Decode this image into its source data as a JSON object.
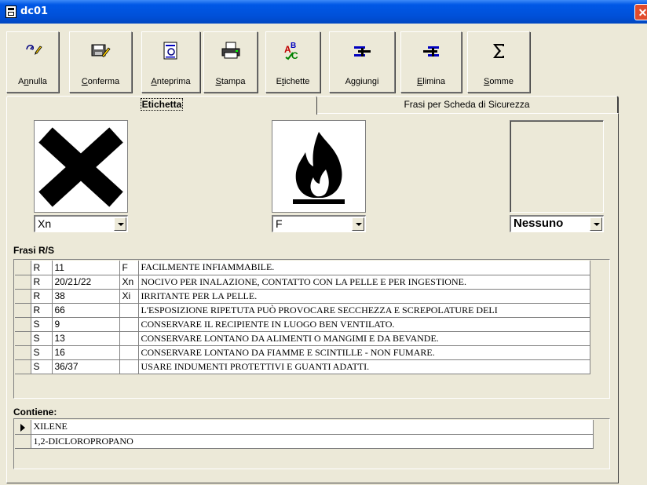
{
  "window": {
    "title": "dc01",
    "close_label": "✕"
  },
  "toolbar": [
    {
      "id": "annulla",
      "pre": "A",
      "u": "n",
      "post": "nulla",
      "icon": "undo-icon"
    },
    {
      "id": "conferma",
      "pre": "",
      "u": "C",
      "post": "onferma",
      "icon": "confirm-icon"
    },
    {
      "id": "anteprima",
      "pre": "",
      "u": "A",
      "post": "nteprima",
      "icon": "preview-icon"
    },
    {
      "id": "stampa",
      "pre": "",
      "u": "S",
      "post": "tampa",
      "icon": "printer-icon"
    },
    {
      "id": "etichette",
      "pre": "E",
      "u": "t",
      "post": "ichette",
      "icon": "labels-icon"
    },
    {
      "id": "aggiungi",
      "pre": "A",
      "u": "g",
      "post": "giungi",
      "icon": "add-icon"
    },
    {
      "id": "elimina",
      "pre": "",
      "u": "E",
      "post": "limina",
      "icon": "remove-icon"
    },
    {
      "id": "somme",
      "pre": "",
      "u": "S",
      "post": "omme",
      "icon": "sum-icon"
    }
  ],
  "tabs": [
    {
      "label": "Etichetta",
      "active": true
    },
    {
      "label": "Frasi per Scheda di Sicurezza",
      "active": false
    }
  ],
  "symbols": [
    {
      "value": "Xn",
      "icon": "harmful-x-icon"
    },
    {
      "value": "F",
      "icon": "flame-icon"
    },
    {
      "value": "Nessuno",
      "icon": ""
    }
  ],
  "phrases": {
    "label": "Frasi R/S",
    "rows": [
      {
        "type": "R",
        "number": "11",
        "symbol": "F",
        "text": "FACILMENTE INFIAMMABILE."
      },
      {
        "type": "R",
        "number": "20/21/22",
        "symbol": "Xn",
        "text": "NOCIVO PER INALAZIONE, CONTATTO CON LA PELLE E PER INGESTIONE."
      },
      {
        "type": "R",
        "number": "38",
        "symbol": "Xi",
        "text": "IRRITANTE PER LA PELLE."
      },
      {
        "type": "R",
        "number": "66",
        "symbol": "",
        "text": "L'ESPOSIZIONE RIPETUTA PUÒ PROVOCARE SECCHEZZA E SCREPOLATURE DELI"
      },
      {
        "type": "S",
        "number": "9",
        "symbol": "",
        "text": "CONSERVARE IL RECIPIENTE IN LUOGO BEN VENTILATO."
      },
      {
        "type": "S",
        "number": "13",
        "symbol": "",
        "text": "CONSERVARE LONTANO DA ALIMENTI O MANGIMI E DA BEVANDE."
      },
      {
        "type": "S",
        "number": "16",
        "symbol": "",
        "text": "CONSERVARE LONTANO DA FIAMME E SCINTILLE - NON FUMARE."
      },
      {
        "type": "S",
        "number": "36/37",
        "symbol": "",
        "text": "USARE INDUMENTI PROTETTIVI E GUANTI ADATTI."
      }
    ]
  },
  "contains": {
    "label": "Contiene:",
    "rows": [
      {
        "name": "XILENE",
        "current": true
      },
      {
        "name": "1,2-DICLOROPROPANO",
        "current": false
      }
    ]
  }
}
